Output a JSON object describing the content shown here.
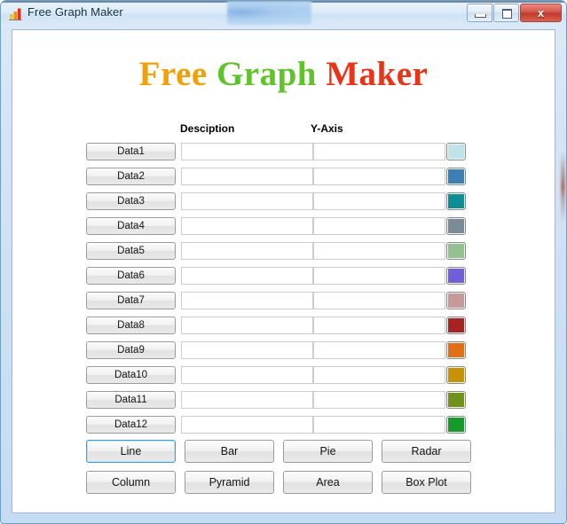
{
  "window": {
    "title": "Free Graph Maker",
    "icon": "bar-chart-icon",
    "buttons": {
      "minimize": "minimize-icon",
      "maximize": "maximize-icon",
      "close": "x"
    }
  },
  "headline": {
    "part1": "Free",
    "part2": "Graph",
    "part3": "Maker",
    "color1": "#f2a007",
    "color2": "#5fc32a",
    "color3": "#e8351a"
  },
  "columns": {
    "description": "Desciption",
    "yaxis": "Y-Axis"
  },
  "rows": [
    {
      "label": "Data1",
      "description": "",
      "yaxis": "",
      "color": "#bfe4e8"
    },
    {
      "label": "Data2",
      "description": "",
      "yaxis": "",
      "color": "#3d7fb4"
    },
    {
      "label": "Data3",
      "description": "",
      "yaxis": "",
      "color": "#0e8e92"
    },
    {
      "label": "Data4",
      "description": "",
      "yaxis": "",
      "color": "#7b8b96"
    },
    {
      "label": "Data5",
      "description": "",
      "yaxis": "",
      "color": "#93c192"
    },
    {
      "label": "Data6",
      "description": "",
      "yaxis": "",
      "color": "#6f5fdb"
    },
    {
      "label": "Data7",
      "description": "",
      "yaxis": "",
      "color": "#c79a9a"
    },
    {
      "label": "Data8",
      "description": "",
      "yaxis": "",
      "color": "#a92222"
    },
    {
      "label": "Data9",
      "description": "",
      "yaxis": "",
      "color": "#df7018"
    },
    {
      "label": "Data10",
      "description": "",
      "yaxis": "",
      "color": "#c79206"
    },
    {
      "label": "Data11",
      "description": "",
      "yaxis": "",
      "color": "#6f921d"
    },
    {
      "label": "Data12",
      "description": "",
      "yaxis": "",
      "color": "#169a2c"
    }
  ],
  "chart_buttons": [
    {
      "label": "Line",
      "selected": true
    },
    {
      "label": "Bar",
      "selected": false
    },
    {
      "label": "Pie",
      "selected": false
    },
    {
      "label": "Radar",
      "selected": false
    },
    {
      "label": "Column",
      "selected": false
    },
    {
      "label": "Pyramid",
      "selected": false
    },
    {
      "label": "Area",
      "selected": false
    },
    {
      "label": "Box Plot",
      "selected": false
    }
  ]
}
